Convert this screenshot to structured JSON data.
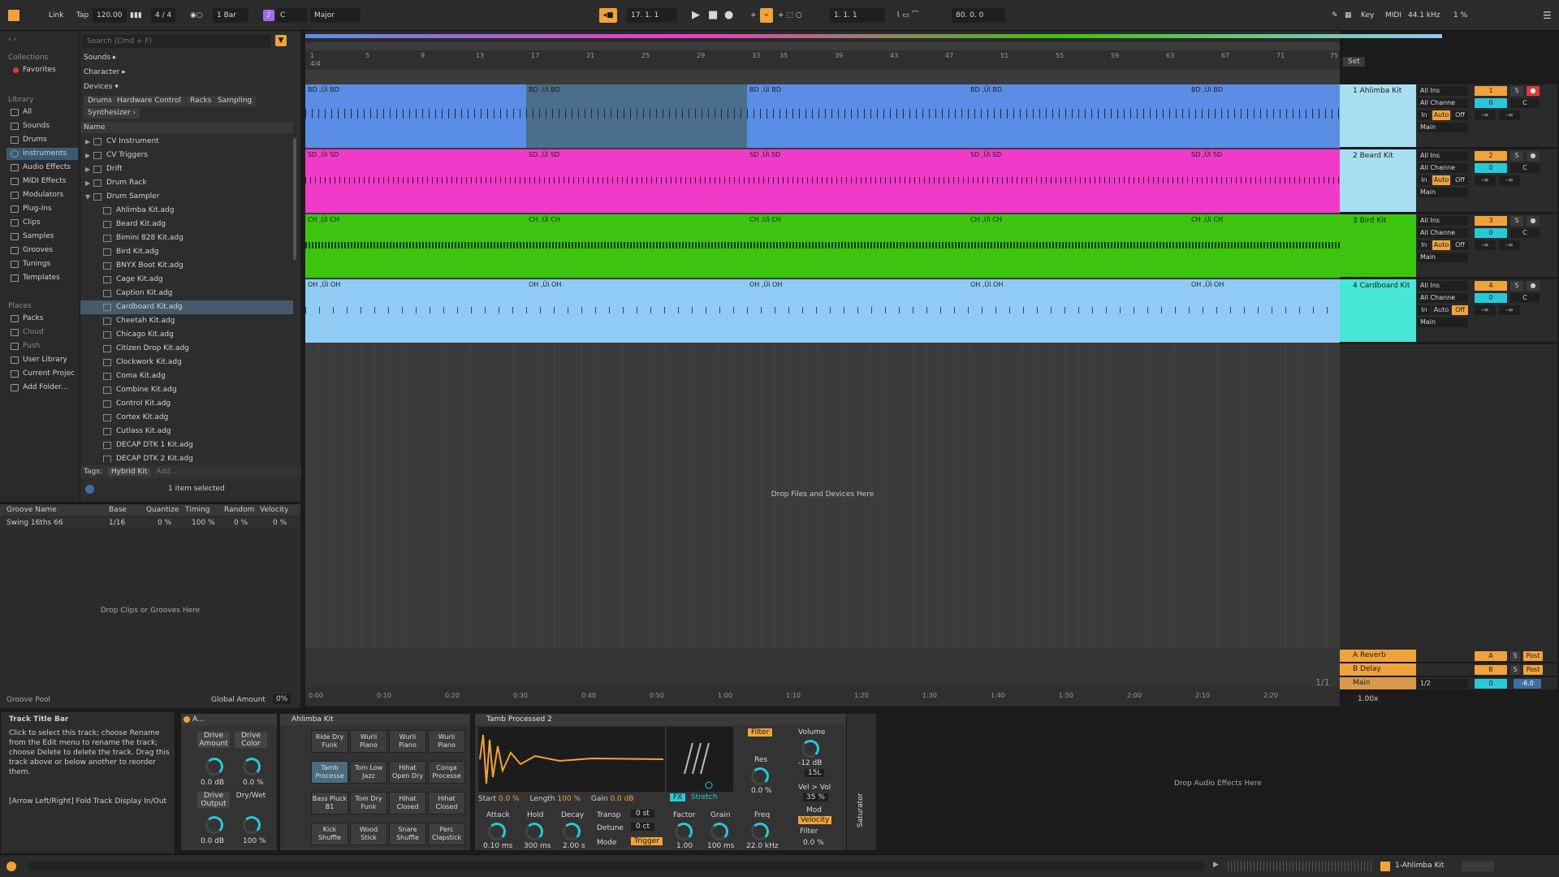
{
  "transport": {
    "link": "Link",
    "tap": "Tap",
    "tempo": "120.00",
    "signature": "4 / 4",
    "quantize": "1 Bar",
    "key": "C",
    "scale": "Major",
    "position": "17.   1.   1",
    "loop_start": "1.   1.   1",
    "loop_length": "80.   0.   0",
    "key_label": "Key",
    "midi_label": "MIDI",
    "sample_rate": "44.1 kHz",
    "cpu": "1 %"
  },
  "browser": {
    "search_placeholder": "Search (Cmd + F)",
    "collections_title": "Collections",
    "favorites": "Favorites",
    "library_title": "Library",
    "library_items": [
      "All",
      "Sounds",
      "Drums",
      "Instruments",
      "Audio Effects",
      "MIDI Effects",
      "Modulators",
      "Plug-Ins",
      "Clips",
      "Samples",
      "Grooves",
      "Tunings",
      "Templates"
    ],
    "places_title": "Places",
    "places_items": [
      "Packs",
      "Cloud",
      "Push",
      "User Library",
      "Current Projec",
      "Add Folder..."
    ],
    "filter_sounds": "Sounds ▸",
    "filter_character": "Character ▸",
    "filter_devices": "Devices ▾",
    "chips": [
      "Drums",
      "Hardware Control",
      "Racks",
      "Sampling",
      "Synthesizer ›"
    ],
    "name_header": "Name",
    "folders": [
      "CV Instrument",
      "CV Triggers",
      "Drift",
      "Drum Rack",
      "Drum Sampler"
    ],
    "files": [
      "Ahlimba Kit.adg",
      "Beard Kit.adg",
      "Bimini 828 Kit.adg",
      "Bird Kit.adg",
      "BNYX Boot Kit.adg",
      "Cage Kit.adg",
      "Caption Kit.adg",
      "Cardboard Kit.adg",
      "Cheetah Kit.adg",
      "Chicago Kit.adg",
      "Citizen Drop Kit.adg",
      "Clockwork Kit.adg",
      "Coma Kit.adg",
      "Combine Kit.adg",
      "Control Kit.adg",
      "Cortex Kit.adg",
      "Cutlass Kit.adg",
      "DECAP DTK 1 Kit.adg",
      "DECAP DTK 2 Kit.adg"
    ],
    "tags_label": "Tags:",
    "tag": "Hybrid Kit",
    "tag_add": "Add...",
    "selection": "1 item selected"
  },
  "groove": {
    "headers": [
      "Groove Name",
      "Base",
      "Quantize",
      "Timing",
      "Random",
      "Velocity"
    ],
    "row": [
      "Swing 16ths 66",
      "1/16",
      "0 %",
      "100 %",
      "0 %",
      "0 %"
    ],
    "drop_hint": "Drop Clips or Grooves Here",
    "pool_label": "Groove Pool",
    "global_amount_label": "Global Amount",
    "global_amount": "0%"
  },
  "info": {
    "title": "Track Title Bar",
    "body": "Click to select this track; choose Rename from the Edit menu to rename the track; choose Delete to delete the track. Drag this track above or below another to reorder them.",
    "shortcut": "[Arrow Left/Right] Fold Track Display In/Out"
  },
  "arrangement": {
    "bar_numbers": [
      "1",
      "5",
      "9",
      "13",
      "17",
      "21",
      "25",
      "29",
      "33",
      "35",
      "39",
      "43",
      "47",
      "51",
      "55",
      "59",
      "63",
      "67",
      "71",
      "75"
    ],
    "time_labels": [
      "0:00",
      "0:10",
      "0:20",
      "0:30",
      "0:40",
      "0:50",
      "1:00",
      "1:10",
      "1:20",
      "1:30",
      "1:40",
      "1:50",
      "2:00",
      "2:10",
      "2:20"
    ],
    "signature_marker": "4/4",
    "drop_hint": "Drop Files and Devices Here",
    "page_indicator": "1/1",
    "zoom": "1.00x",
    "set_label": "Set",
    "tracks": [
      {
        "clip_label": "BD ,Üì BD",
        "name": "1 Ahlimba Kit",
        "color": "#5a8de6",
        "head": "#a9dff2",
        "num": "1",
        "in": "All Ins",
        "chan": "All Channe",
        "out": "Main",
        "auto": "Auto",
        "off": "Off"
      },
      {
        "clip_label": "SD ,Üì SD",
        "name": "2 Beard Kit",
        "color": "#f03bc8",
        "head": "#a9dff2",
        "num": "2",
        "in": "All Ins",
        "chan": "All Channe",
        "out": "Main",
        "auto": "Auto",
        "off": "Off"
      },
      {
        "clip_label": "CH ,Üì CH",
        "name": "3 Bird Kit",
        "color": "#3cc40e",
        "head": "#3cc40e",
        "num": "3",
        "in": "All Ins",
        "chan": "All Channe",
        "out": "Main",
        "auto": "Auto",
        "off": "Off"
      },
      {
        "clip_label": "OH ,Üì OH",
        "name": "4 Cardboard Kit",
        "color": "#8fcbf4",
        "head": "#47e6d6",
        "num": "4",
        "in": "All Ins",
        "chan": "All Channe",
        "out": "Main",
        "auto": "Auto",
        "off": "Off"
      }
    ],
    "returns": [
      {
        "name": "A Reverb",
        "letter": "A",
        "post": "Post"
      },
      {
        "name": "B Delay",
        "letter": "B",
        "post": "Post"
      }
    ],
    "main": {
      "name": "Main",
      "routing": "1/2",
      "vol": "0",
      "db": "-6.0"
    },
    "vol_value": "0",
    "pan_value": "C",
    "inf": "-∞",
    "in_label": "In"
  },
  "devices": {
    "rack_name": "A...",
    "saturator_title": "Saturator",
    "drive_amount": "Drive Amount",
    "drive_color": "Drive Color",
    "drive_amount_val": "0.0 dB",
    "drive_color_val": "0.0 %",
    "drive_output": "Drive Output",
    "dry_wet": "Dry/Wet",
    "drive_output_val": "0.0 dB",
    "dry_wet_val": "100 %",
    "kit_title": "Ahlimba Kit",
    "pads": [
      "Ride Dry Funk",
      "Wurli Piano",
      "Wurli Piano",
      "Wurli Piano",
      "Tamb Processe",
      "Tom Low Jazz",
      "Hihat Open Dry",
      "Conga Processe",
      "Bass Pluck B1",
      "Tom Dry Funk",
      "Hihat Closed",
      "Hihat Closed",
      "Kick Shuffle",
      "Wood Stick",
      "Snare Shuffle",
      "Perc Clapstick"
    ],
    "sampler_title": "Tamb Processed 2",
    "start_label": "Start",
    "start": "0.0 %",
    "length_label": "Length",
    "length": "100 %",
    "gain_label": "Gain",
    "gain": "0.0 dB",
    "fx_label": "FX",
    "stretch": "Stretch",
    "attack_label": "Attack",
    "attack": "0.10 ms",
    "hold_label": "Hold",
    "hold": "300 ms",
    "decay_label": "Decay",
    "decay": "2.00 s",
    "transp_label": "Transp",
    "transp": "0 st",
    "detune_label": "Detune",
    "detune": "0 ct",
    "mode_label": "Mode",
    "mode": "Trigger",
    "factor_label": "Factor",
    "factor": "1.00",
    "grain_label": "Grain",
    "grain": "100 ms",
    "filter_label": "Filter",
    "res_label": "Res",
    "res": "0.0 %",
    "freq_label": "Freq",
    "freq": "22.0 kHz",
    "volume_label": "Volume",
    "volume": "-12 dB",
    "vel_vol_label": "Vel > Vol",
    "vel_vol": "35 %",
    "mod_label": "Mod",
    "velocity": "Velocity",
    "mod_filter": "Filter",
    "mod_amount": "0.0 %",
    "vol_box": "15L",
    "drop_audio": "Drop Audio Effects Here"
  },
  "status": {
    "track_name": "1-Ahlimba Kit"
  },
  "colors": {
    "accent": "#f0a33a",
    "cyan": "#29c8d8",
    "selection": "#3a5a74"
  }
}
